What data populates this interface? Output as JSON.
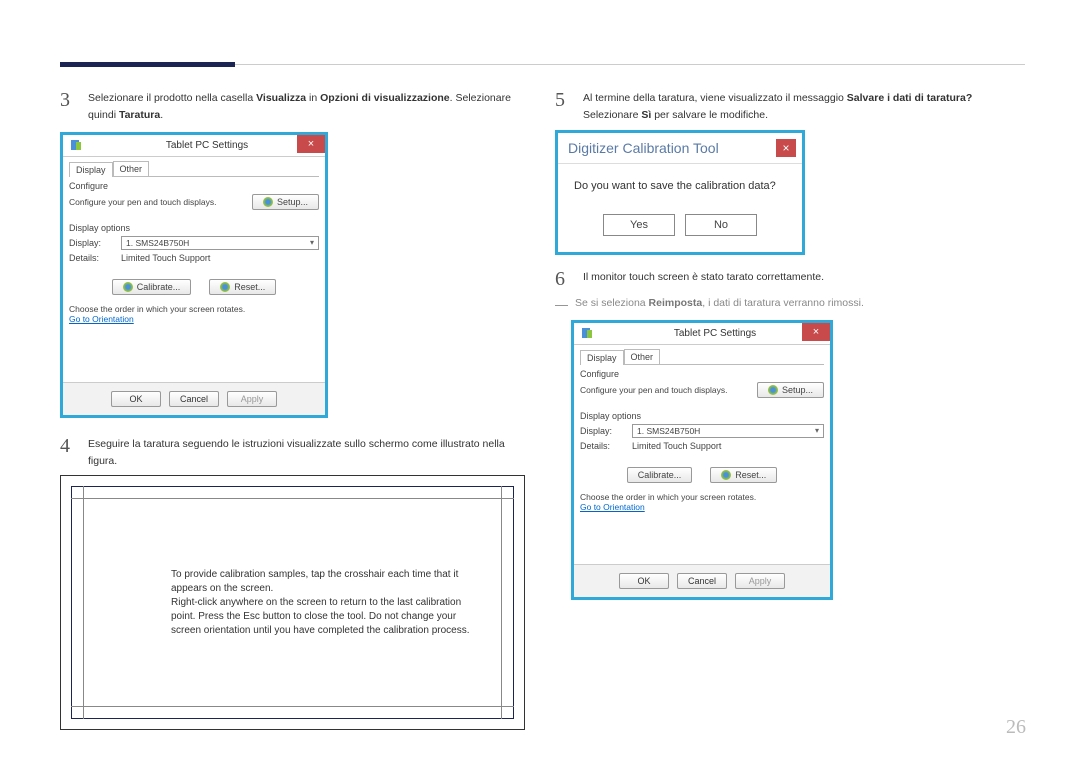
{
  "page_number": "26",
  "left": {
    "step3": {
      "num": "3",
      "part1": "Selezionare il prodotto nella casella ",
      "b1": "Visualizza",
      "part2": " in ",
      "b2": "Opzioni di visualizzazione",
      "part3": ". Selezionare quindi ",
      "b3": "Taratura",
      "part4": "."
    },
    "dlg": {
      "title": "Tablet PC Settings",
      "tabs": {
        "display": "Display",
        "other": "Other"
      },
      "configure": "Configure",
      "configure_sub": "Configure your pen and touch displays.",
      "setup_btn": "Setup...",
      "display_options": "Display options",
      "display_label": "Display:",
      "display_value": "1. SMS24B750H",
      "details_label": "Details:",
      "details_value": "Limited Touch Support",
      "calibrate_btn": "Calibrate...",
      "reset_btn": "Reset...",
      "rotate_msg": "Choose the order in which your screen rotates.",
      "link": "Go to Orientation",
      "ok": "OK",
      "cancel": "Cancel",
      "apply": "Apply"
    },
    "step4": {
      "num": "4",
      "text": "Eseguire la taratura seguendo le istruzioni visualizzate sullo schermo come illustrato nella figura."
    },
    "calib_text1": "To provide calibration samples, tap the crosshair each time that it appears on the screen.",
    "calib_text2": "Right-click anywhere on the screen to return to the last calibration point. Press the Esc button to close the tool. Do not change your screen orientation until you have completed the calibration process."
  },
  "right": {
    "step5": {
      "num": "5",
      "part1": "Al termine della taratura, viene visualizzato il messaggio ",
      "b1": "Salvare i dati di taratura?",
      "part2": " Selezionare ",
      "b2": "Sì",
      "part3": " per salvare le modifiche."
    },
    "digi": {
      "title": "Digitizer Calibration Tool",
      "question": "Do you want to save the calibration data?",
      "yes": "Yes",
      "no": "No"
    },
    "step6": {
      "num": "6",
      "text": "Il monitor touch screen è stato tarato correttamente."
    },
    "note": {
      "dash": "―",
      "part1": "Se si seleziona ",
      "b1": "Reimposta",
      "part2": ", i dati di taratura verranno rimossi."
    }
  }
}
